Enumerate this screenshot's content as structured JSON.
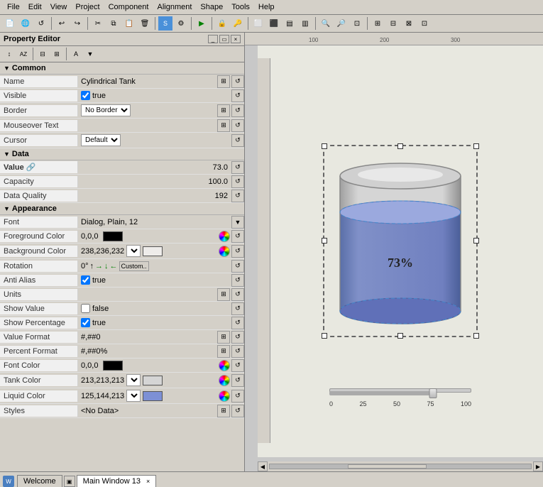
{
  "menubar": {
    "items": [
      "File",
      "Edit",
      "View",
      "Project",
      "Component",
      "Alignment",
      "Shape",
      "Tools",
      "Help"
    ]
  },
  "property_editor": {
    "title": "Property Editor",
    "sections": {
      "common": {
        "label": "Common",
        "rows": [
          {
            "key": "name",
            "label": "Name",
            "value": "Cylindrical Tank",
            "type": "text"
          },
          {
            "key": "visible",
            "label": "Visible",
            "value": "true",
            "type": "checkbox",
            "checked": true
          },
          {
            "key": "border",
            "label": "Border",
            "value": "No Border",
            "type": "select"
          },
          {
            "key": "mouseover_text",
            "label": "Mouseover Text",
            "value": "",
            "type": "text_icon"
          },
          {
            "key": "cursor",
            "label": "Cursor",
            "value": "Default",
            "type": "select"
          }
        ]
      },
      "data": {
        "label": "Data",
        "rows": [
          {
            "key": "value",
            "label": "Value",
            "value": "73.0",
            "type": "number",
            "bold": true,
            "has_link": true
          },
          {
            "key": "capacity",
            "label": "Capacity",
            "value": "100.0",
            "type": "number"
          },
          {
            "key": "data_quality",
            "label": "Data Quality",
            "value": "192",
            "type": "number"
          }
        ]
      },
      "appearance": {
        "label": "Appearance",
        "rows": [
          {
            "key": "font",
            "label": "Font",
            "value": "Dialog, Plain, 12",
            "type": "font"
          },
          {
            "key": "foreground_color",
            "label": "Foreground Color",
            "value": "0,0,0",
            "type": "color",
            "color": "#000000"
          },
          {
            "key": "background_color",
            "label": "Background Color",
            "value": "238,236,232",
            "type": "color_select",
            "color": "#eeecea"
          },
          {
            "key": "rotation",
            "label": "Rotation",
            "value": "0°",
            "type": "rotation"
          },
          {
            "key": "anti_alias",
            "label": "Anti Alias",
            "value": "true",
            "type": "checkbox",
            "checked": true
          },
          {
            "key": "units",
            "label": "Units",
            "value": "",
            "type": "text_icon"
          },
          {
            "key": "show_value",
            "label": "Show Value",
            "value": "false",
            "type": "checkbox",
            "checked": false
          },
          {
            "key": "show_percentage",
            "label": "Show Percentage",
            "value": "true",
            "type": "checkbox",
            "checked": true
          },
          {
            "key": "value_format",
            "label": "Value Format",
            "value": "#,##0",
            "type": "text_icon"
          },
          {
            "key": "percent_format",
            "label": "Percent Format",
            "value": "#,##0%",
            "type": "text_icon"
          },
          {
            "key": "font_color",
            "label": "Font Color",
            "value": "0,0,0",
            "type": "color",
            "color": "#000000"
          },
          {
            "key": "tank_color",
            "label": "Tank Color",
            "value": "213,213,213",
            "type": "color_select2",
            "color": "#d5d5d5"
          },
          {
            "key": "liquid_color",
            "label": "Liquid Color",
            "value": "125,144,213",
            "type": "color_select2",
            "color": "#7d90d5"
          },
          {
            "key": "styles",
            "label": "Styles",
            "value": "<No Data>",
            "type": "text_icon"
          }
        ]
      }
    }
  },
  "canvas": {
    "tank_percent": "73%",
    "slider_labels": [
      "0",
      "25",
      "50",
      "75",
      "100"
    ],
    "ruler_marks": [
      "100",
      "200",
      "300"
    ]
  },
  "tabs": {
    "items": [
      {
        "label": "Welcome",
        "active": false,
        "closable": false
      },
      {
        "label": "Main Window 13",
        "active": true,
        "closable": true
      }
    ]
  }
}
